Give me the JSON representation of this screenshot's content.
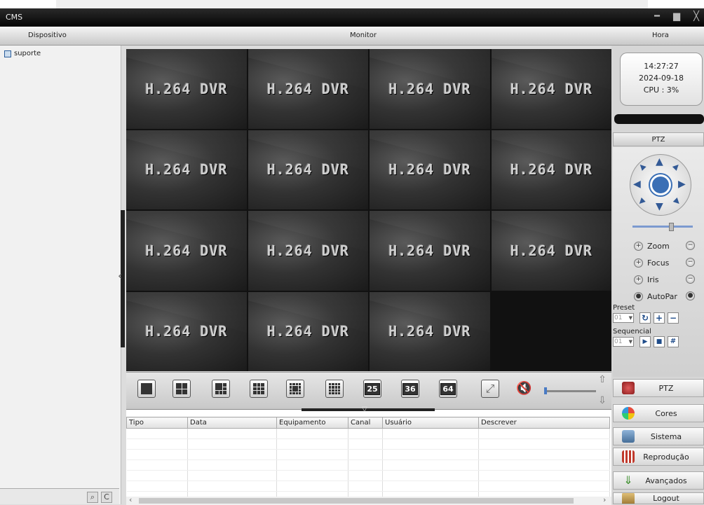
{
  "window": {
    "title": "CMS",
    "controls": {
      "minimize": "━",
      "maximize": "▆",
      "close": "╳"
    }
  },
  "header": {
    "left": "Dispositivo",
    "center": "Monitor",
    "right": "Hora"
  },
  "tree": {
    "items": [
      {
        "label": "suporte"
      }
    ]
  },
  "search": {
    "search_icon": "⌕",
    "refresh_icon": "C"
  },
  "video": {
    "label": "H.264 DVR",
    "channels": 16,
    "selected_index": 0
  },
  "toolbar": {
    "n25": "25",
    "n36": "36",
    "n64": "64"
  },
  "log": {
    "columns": [
      "Tipo",
      "Data",
      "Equipamento",
      "Canal",
      "Usuário",
      "Descrever"
    ]
  },
  "clock": {
    "time": "14:27:27",
    "date": "2024-09-18",
    "cpu": "CPU : 3%"
  },
  "ptz": {
    "title": "PTZ",
    "zoom": "Zoom",
    "focus": "Focus",
    "iris": "Iris",
    "autopan": "AutoPar",
    "preset_label": "Preset",
    "preset_value": "01",
    "sequence_label": "Sequencial",
    "sequence_value": "01"
  },
  "menu": {
    "ptz": "PTZ",
    "cores": "Cores",
    "sistema": "Sistema",
    "reproducao": "Reprodução",
    "avancados": "Avançados",
    "logout": "Logout"
  },
  "colors": {
    "accent": "#3a6fb5",
    "selection": "#6fb94d",
    "titlebar": "#0a0a0a"
  }
}
